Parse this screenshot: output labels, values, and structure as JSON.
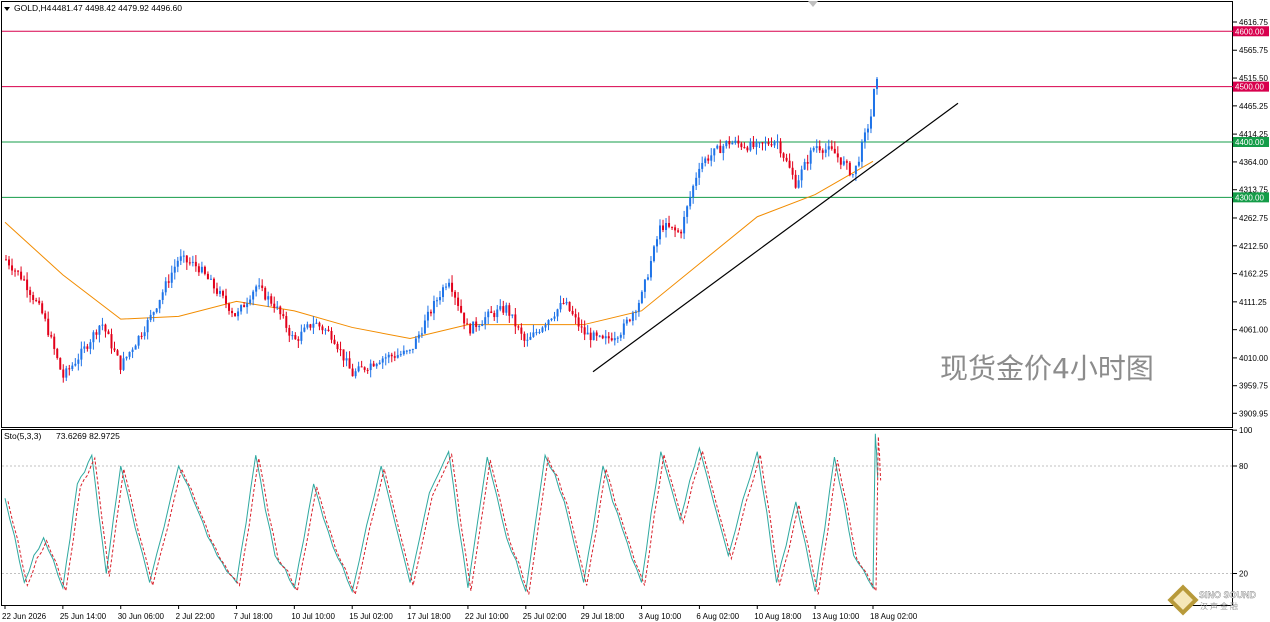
{
  "header": {
    "symbol": "GOLD,H4",
    "ohlc": "4481.47 4498.42 4479.92 4496.60"
  },
  "watermark": "现货金价4小时图",
  "logo": {
    "line1": "SINO SOUND",
    "line2": "汉声金融"
  },
  "colors": {
    "bull": "#1e73e8",
    "bear": "#e2001a",
    "ma": "#f28c00",
    "resistance_line": "#d8004d",
    "support_line": "#149c48",
    "trendline": "#000000",
    "stoch_main": "#2fa8a0",
    "stoch_signal": "#d8202a"
  },
  "chart_data": [
    {
      "type": "candlestick",
      "symbol": "GOLD",
      "timeframe": "H4",
      "ohlc_last": {
        "open": 4481.47,
        "high": 4498.42,
        "low": 4479.92,
        "close": 4496.6
      },
      "ylim": [
        3880,
        4660
      ],
      "y_ticks": [
        "4616.75",
        "4565.75",
        "4515.50",
        "4465.25",
        "4414.25",
        "4364.00",
        "4313.75",
        "4262.75",
        "4212.50",
        "4162.25",
        "4111.25",
        "4061.00",
        "4010.00",
        "3959.75",
        "3909.95"
      ],
      "x_ticks": [
        "22 Jun 2026",
        "25 Jun 14:00",
        "30 Jun 06:00",
        "2 Jul 22:00",
        "7 Jul 18:00",
        "10 Jul 10:00",
        "15 Jul 02:00",
        "17 Jul 18:00",
        "22 Jul 10:00",
        "25 Jul 02:00",
        "29 Jul 18:00",
        "3 Aug 10:00",
        "6 Aug 02:00",
        "10 Aug 18:00",
        "13 Aug 10:00",
        "18 Aug 02:00"
      ],
      "price_levels": [
        {
          "value": 4600,
          "label": "4600.00",
          "role": "resistance"
        },
        {
          "value": 4500,
          "label": "4500.00",
          "role": "resistance"
        },
        {
          "value": 4400,
          "label": "4400.00",
          "role": "support"
        },
        {
          "value": 4300,
          "label": "4300.00",
          "role": "support"
        }
      ],
      "trendline": {
        "from": [
          "25 Jul 02:00",
          3985
        ],
        "to": [
          "after 18 Aug 02:00",
          4470
        ]
      },
      "close_path": [
        [
          "22 Jun 2026",
          4190
        ],
        [
          "23 Jun",
          4150
        ],
        [
          "24 Jun",
          4085
        ],
        [
          "25 Jun 14:00",
          3975
        ],
        [
          "26 Jun",
          4020
        ],
        [
          "27 Jun",
          4075
        ],
        [
          "30 Jun 06:00",
          3995
        ],
        [
          "1 Jul",
          4080
        ],
        [
          "2 Jul 22:00",
          4190
        ],
        [
          "3 Jul",
          4175
        ],
        [
          "6 Jul",
          4130
        ],
        [
          "7 Jul 18:00",
          4085
        ],
        [
          "8 Jul",
          4140
        ],
        [
          "9 Jul",
          4105
        ],
        [
          "10 Jul 10:00",
          4040
        ],
        [
          "11 Jul",
          4075
        ],
        [
          "14 Jul",
          4050
        ],
        [
          "15 Jul 02:00",
          3980
        ],
        [
          "16 Jul",
          4010
        ],
        [
          "17 Jul 18:00",
          4020
        ],
        [
          "20 Jul",
          4090
        ],
        [
          "21 Jul",
          4155
        ],
        [
          "22 Jul 10:00",
          4060
        ],
        [
          "23 Jul",
          4085
        ],
        [
          "24 Jul",
          4100
        ],
        [
          "25 Jul 02:00",
          4035
        ],
        [
          "27 Jul",
          4075
        ],
        [
          "28 Jul",
          4110
        ],
        [
          "29 Jul 18:00",
          4055
        ],
        [
          "30 Jul",
          4040
        ],
        [
          "31 Jul",
          4060
        ],
        [
          "3 Aug 10:00",
          4120
        ],
        [
          "4 Aug",
          4250
        ],
        [
          "5 Aug",
          4235
        ],
        [
          "6 Aug 02:00",
          4360
        ],
        [
          "7 Aug",
          4400
        ],
        [
          "10 Aug 18:00",
          4390
        ],
        [
          "11 Aug",
          4405
        ],
        [
          "12 Aug",
          4325
        ],
        [
          "13 Aug 10:00",
          4395
        ],
        [
          "14 Aug",
          4380
        ],
        [
          "17 Aug",
          4340
        ],
        [
          "18 Aug 02:00",
          4460
        ],
        [
          "18 Aug",
          4530
        ],
        [
          "19 Aug",
          4496.6
        ]
      ],
      "ma_path": [
        [
          "22 Jun 2026",
          4255
        ],
        [
          "25 Jun 14:00",
          4160
        ],
        [
          "30 Jun 06:00",
          4080
        ],
        [
          "2 Jul 22:00",
          4085
        ],
        [
          "7 Jul 18:00",
          4112
        ],
        [
          "10 Jul 10:00",
          4095
        ],
        [
          "15 Jul 02:00",
          4065
        ],
        [
          "17 Jul 18:00",
          4045
        ],
        [
          "22 Jul 10:00",
          4070
        ],
        [
          "25 Jul 02:00",
          4070
        ],
        [
          "29 Jul 18:00",
          4070
        ],
        [
          "3 Aug 10:00",
          4095
        ],
        [
          "6 Aug 02:00",
          4180
        ],
        [
          "10 Aug 18:00",
          4265
        ],
        [
          "13 Aug 10:00",
          4305
        ],
        [
          "18 Aug 02:00",
          4365
        ]
      ]
    },
    {
      "type": "line",
      "indicator": "Stochastic",
      "label": "Sto(5,3,3)",
      "values_text": "73.6269 82.9725",
      "main_last": 73.6269,
      "signal_last": 82.9725,
      "ylim": [
        0,
        100
      ],
      "y_ticks": [
        "100",
        "80",
        "20"
      ],
      "levels": [
        80,
        20
      ],
      "main_path": [
        [
          "22 Jun 2026",
          62
        ],
        [
          "23 Jun",
          15
        ],
        [
          "24 Jun",
          40
        ],
        [
          "25 Jun 14:00",
          12
        ],
        [
          "26 Jun",
          70
        ],
        [
          "27 Jun",
          86
        ],
        [
          "29 Jun",
          20
        ],
        [
          "30 Jun 06:00",
          80
        ],
        [
          "1 Jul",
          15
        ],
        [
          "2 Jul 22:00",
          80
        ],
        [
          "3 Jul",
          55
        ],
        [
          "6 Jul",
          30
        ],
        [
          "7 Jul 18:00",
          15
        ],
        [
          "8 Jul",
          86
        ],
        [
          "9 Jul",
          30
        ],
        [
          "10 Jul 10:00",
          12
        ],
        [
          "13 Jul",
          70
        ],
        [
          "14 Jul",
          35
        ],
        [
          "15 Jul 02:00",
          10
        ],
        [
          "16 Jul",
          80
        ],
        [
          "17 Jul 18:00",
          15
        ],
        [
          "20 Jul",
          65
        ],
        [
          "21 Jul",
          88
        ],
        [
          "22 Jul 10:00",
          12
        ],
        [
          "23 Jul",
          85
        ],
        [
          "24 Jul",
          40
        ],
        [
          "25 Jul 02:00",
          10
        ],
        [
          "27 Jul",
          86
        ],
        [
          "28 Jul",
          60
        ],
        [
          "29 Jul 18:00",
          15
        ],
        [
          "30 Jul",
          80
        ],
        [
          "31 Jul",
          45
        ],
        [
          "3 Aug 10:00",
          15
        ],
        [
          "4 Aug",
          88
        ],
        [
          "5 Aug",
          50
        ],
        [
          "6 Aug 02:00",
          90
        ],
        [
          "7 Aug",
          30
        ],
        [
          "10 Aug 18:00",
          88
        ],
        [
          "11 Aug",
          15
        ],
        [
          "12 Aug",
          60
        ],
        [
          "13 Aug 10:00",
          10
        ],
        [
          "14 Aug",
          85
        ],
        [
          "17 Aug",
          30
        ],
        [
          "18 Aug 02:00",
          12
        ],
        [
          "18 Aug",
          98
        ],
        [
          "19 Aug",
          73.6269
        ]
      ]
    }
  ]
}
